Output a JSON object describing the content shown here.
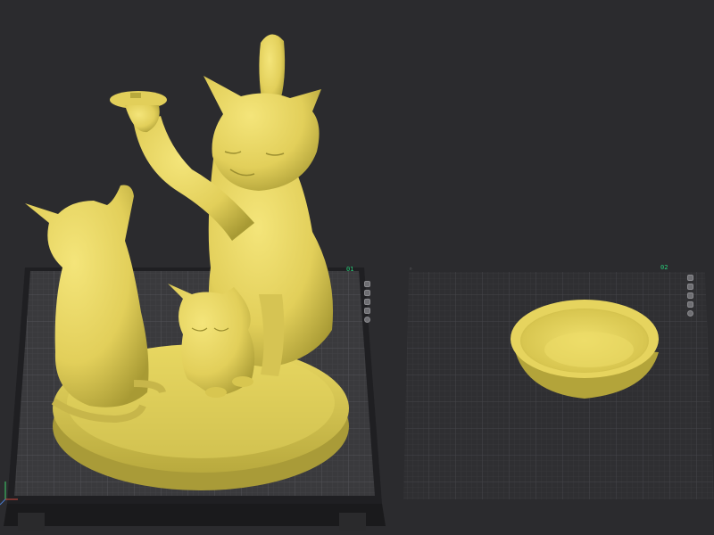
{
  "plates": [
    {
      "label": "01",
      "icon": "plate-toolbar"
    },
    {
      "label": "02",
      "icon": "plate-toolbar"
    }
  ],
  "colors": {
    "background": "#2b2b2e",
    "plate_surface": "#3a3a3d",
    "plate_grid": "#4a4a4e",
    "model": "#e4d25e",
    "model_shadow": "#b8a93c",
    "label_green": "#27d07a"
  },
  "objects": [
    {
      "name": "cat-family-figurine",
      "plate": "01"
    },
    {
      "name": "dish-bowl",
      "plate": "02"
    }
  ]
}
